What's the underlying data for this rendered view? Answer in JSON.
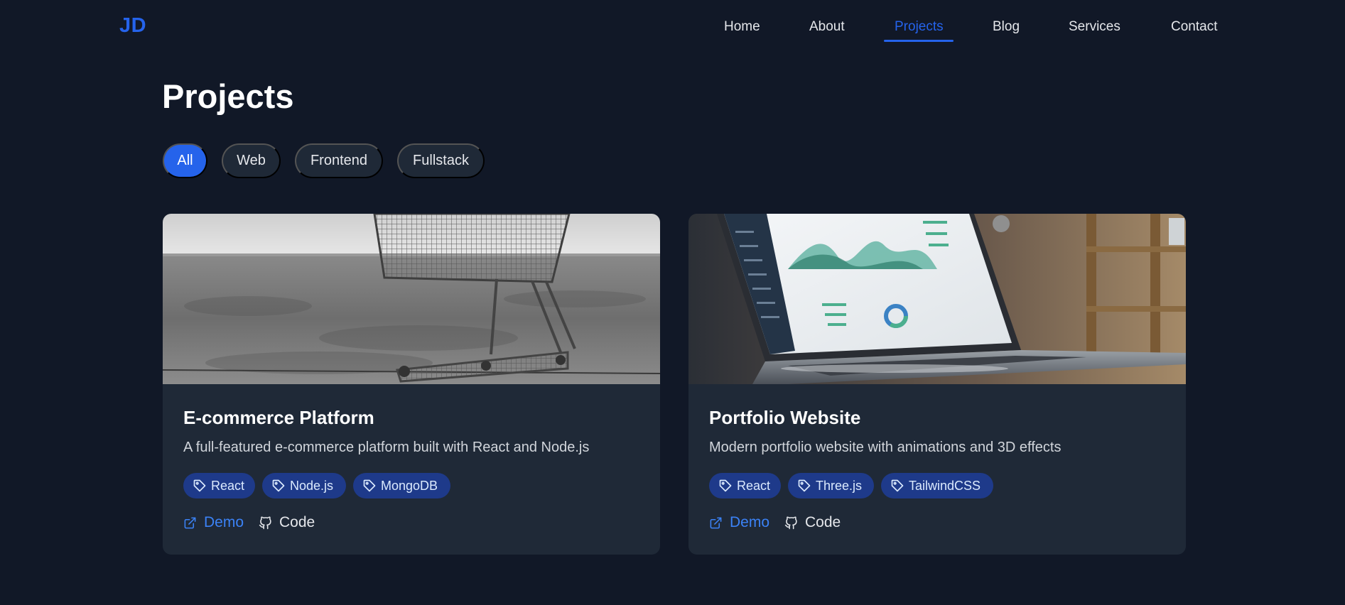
{
  "nav": {
    "logo": "JD",
    "links": [
      "Home",
      "About",
      "Projects",
      "Blog",
      "Services",
      "Contact"
    ],
    "active": "Projects"
  },
  "page": {
    "title": "Projects"
  },
  "filters": {
    "options": [
      "All",
      "Web",
      "Frontend",
      "Fullstack"
    ],
    "active": "All"
  },
  "projects": [
    {
      "title": "E-commerce Platform",
      "description": "A full-featured e-commerce platform built with React and Node.js",
      "image": "shopping-cart-photo",
      "tags": [
        "React",
        "Node.js",
        "MongoDB"
      ],
      "demo_label": "Demo",
      "code_label": "Code"
    },
    {
      "title": "Portfolio Website",
      "description": "Modern portfolio website with animations and 3D effects",
      "image": "laptop-dashboard-photo",
      "tags": [
        "React",
        "Three.js",
        "TailwindCSS"
      ],
      "demo_label": "Demo",
      "code_label": "Code"
    }
  ],
  "colors": {
    "background": "#111827",
    "card": "#1f2937",
    "accent": "#2563eb",
    "tag_bg": "#1e3a8a"
  }
}
